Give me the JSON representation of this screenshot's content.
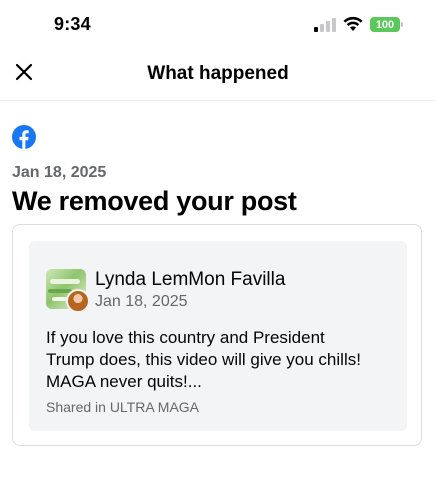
{
  "status_bar": {
    "time": "9:34",
    "battery": "100",
    "signal_icon": "cellular-signal-icon",
    "wifi_icon": "wifi-icon"
  },
  "nav": {
    "title": "What happened",
    "close_icon": "close-icon"
  },
  "notice": {
    "logo_icon": "facebook-logo-icon",
    "date": "Jan 18, 2025",
    "headline": "We removed your post"
  },
  "post": {
    "author": "Lynda LemMon Favilla",
    "date": "Jan 18, 2025",
    "text_lines": [
      "If you love this country and President",
      "Trump does, this video will give you chills!",
      "MAGA never quits!..."
    ],
    "shared_in": "Shared in ULTRA MAGA"
  },
  "colors": {
    "facebook_blue": "#1877f2",
    "battery_green": "#5ac85a",
    "secondary_text": "#65676b",
    "card_bg": "#f3f4f6"
  }
}
